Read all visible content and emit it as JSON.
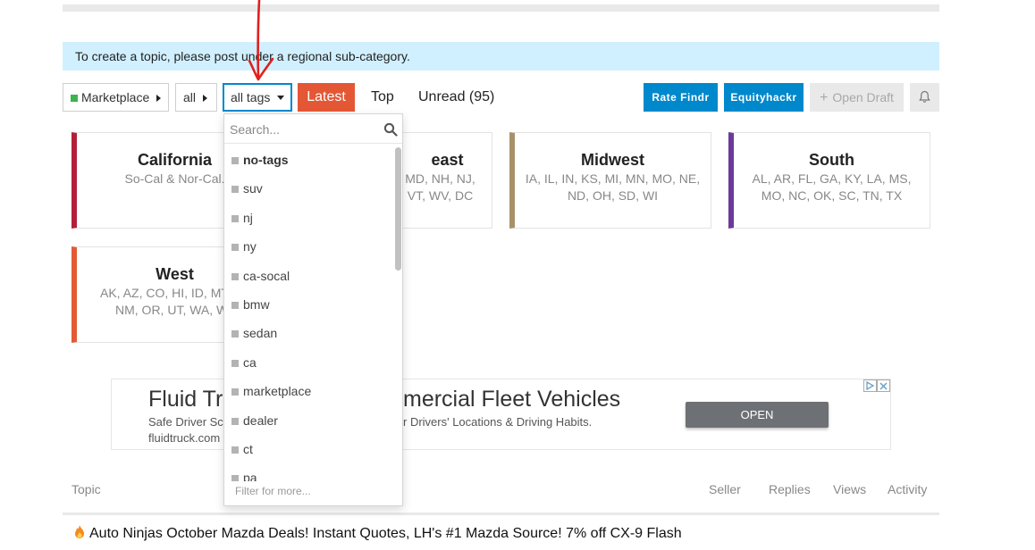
{
  "notice": "To create a topic, please post under a regional sub-category.",
  "nav": {
    "category": "Marketplace",
    "subcategory": "all",
    "tags": "all tags",
    "latest": "Latest",
    "top": "Top",
    "unread": "Unread (95)",
    "rate_findr": "Rate Findr",
    "equityhackr": "Equityhackr",
    "open_draft": "Open Draft",
    "colors": {
      "latest": "#e45735",
      "blue": "#0088cc",
      "category_square": "#3ab54a"
    }
  },
  "regions": [
    {
      "name": "California",
      "states": "So-Cal & Nor-Cal.",
      "color": "#b3203a"
    },
    {
      "name": "Northeast",
      "name_visible": "east",
      "states_line1": "MD, NH, NJ,",
      "states_line2": "VT, WV, DC",
      "color": "#b3203a"
    },
    {
      "name": "Midwest",
      "states_line1": "IA, IL, IN, KS, MI, MN, MO, NE,",
      "states_line2": "ND, OH, SD, WI",
      "color": "#a8916a"
    },
    {
      "name": "South",
      "states_line1": "AL, AR, FL, GA, KY, LA, MS,",
      "states_line2": "MO, NC, OK, SC, TN, TX",
      "color": "#6b3a9a"
    },
    {
      "name": "West",
      "states_line1": "AK, AZ, CO, HI, ID, MT",
      "states_line2": "NM, OR, UT, WA, W",
      "color": "#e25b33"
    }
  ],
  "ad": {
    "headline_left": "Fluid Tr",
    "headline_right": "mercial Fleet Vehicles",
    "sub1_left": "Safe Driver Sco",
    "sub1_right": "r Drivers' Locations & Driving Habits.",
    "domain": "fluidtruck.com",
    "cta": "OPEN"
  },
  "table": {
    "headers": {
      "topic": "Topic",
      "seller": "Seller",
      "replies": "Replies",
      "views": "Views",
      "activity": "Activity"
    },
    "first_row_title": "Auto Ninjas October Mazda Deals! Instant Quotes, LH's #1 Mazda Source! 7% off CX-9 Flash"
  },
  "dropdown": {
    "placeholder": "Search...",
    "items": [
      "no-tags",
      "suv",
      "nj",
      "ny",
      "ca-socal",
      "bmw",
      "sedan",
      "ca",
      "marketplace",
      "dealer",
      "ct",
      "pa"
    ],
    "filter_hint": "Filter for more..."
  }
}
